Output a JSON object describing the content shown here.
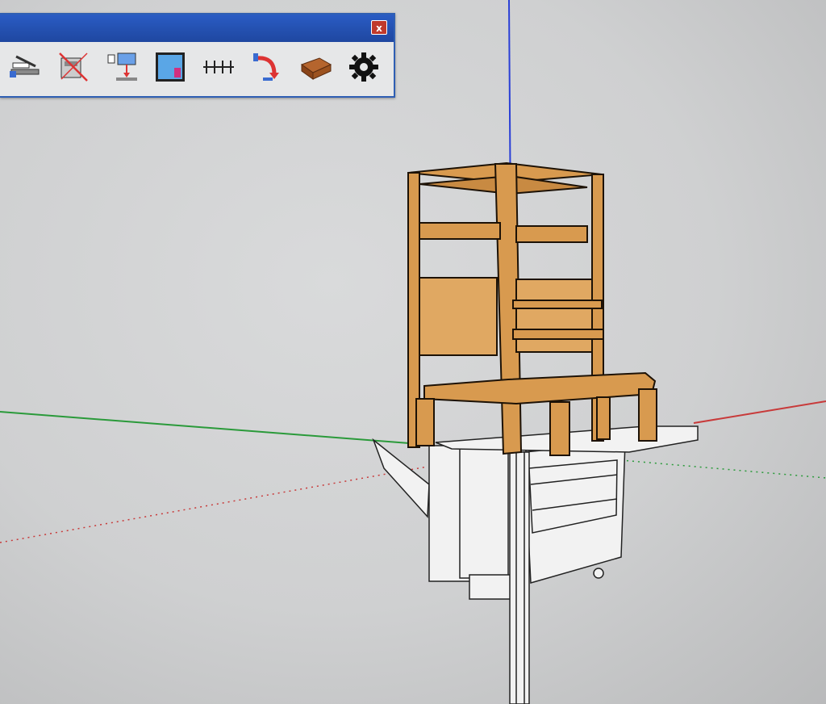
{
  "window": {
    "toolbar_title": "",
    "close_label": "x"
  },
  "toolbar": {
    "tools": [
      {
        "icon": "layout-stack-icon"
      },
      {
        "icon": "delete-stack-icon"
      },
      {
        "icon": "insert-component-icon"
      },
      {
        "icon": "panel-material-icon"
      },
      {
        "icon": "dimension-ruler-icon"
      },
      {
        "icon": "rotate-arrow-icon"
      },
      {
        "icon": "brick-material-icon"
      },
      {
        "icon": "settings-gear-icon"
      }
    ]
  },
  "colors": {
    "title_bar": "#2a5cc4",
    "wood": "#d89a4f",
    "axis_blue": "#2a3fd6",
    "axis_red": "#c83a3a",
    "axis_green": "#2a9a3a"
  }
}
